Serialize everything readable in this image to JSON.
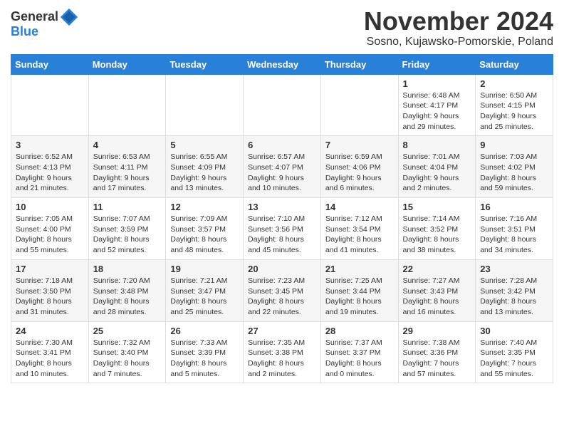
{
  "header": {
    "logo_general": "General",
    "logo_blue": "Blue",
    "month_title": "November 2024",
    "location": "Sosno, Kujawsko-Pomorskie, Poland"
  },
  "weekdays": [
    "Sunday",
    "Monday",
    "Tuesday",
    "Wednesday",
    "Thursday",
    "Friday",
    "Saturday"
  ],
  "weeks": [
    [
      {
        "day": "",
        "info": ""
      },
      {
        "day": "",
        "info": ""
      },
      {
        "day": "",
        "info": ""
      },
      {
        "day": "",
        "info": ""
      },
      {
        "day": "",
        "info": ""
      },
      {
        "day": "1",
        "info": "Sunrise: 6:48 AM\nSunset: 4:17 PM\nDaylight: 9 hours and 29 minutes."
      },
      {
        "day": "2",
        "info": "Sunrise: 6:50 AM\nSunset: 4:15 PM\nDaylight: 9 hours and 25 minutes."
      }
    ],
    [
      {
        "day": "3",
        "info": "Sunrise: 6:52 AM\nSunset: 4:13 PM\nDaylight: 9 hours and 21 minutes."
      },
      {
        "day": "4",
        "info": "Sunrise: 6:53 AM\nSunset: 4:11 PM\nDaylight: 9 hours and 17 minutes."
      },
      {
        "day": "5",
        "info": "Sunrise: 6:55 AM\nSunset: 4:09 PM\nDaylight: 9 hours and 13 minutes."
      },
      {
        "day": "6",
        "info": "Sunrise: 6:57 AM\nSunset: 4:07 PM\nDaylight: 9 hours and 10 minutes."
      },
      {
        "day": "7",
        "info": "Sunrise: 6:59 AM\nSunset: 4:06 PM\nDaylight: 9 hours and 6 minutes."
      },
      {
        "day": "8",
        "info": "Sunrise: 7:01 AM\nSunset: 4:04 PM\nDaylight: 9 hours and 2 minutes."
      },
      {
        "day": "9",
        "info": "Sunrise: 7:03 AM\nSunset: 4:02 PM\nDaylight: 8 hours and 59 minutes."
      }
    ],
    [
      {
        "day": "10",
        "info": "Sunrise: 7:05 AM\nSunset: 4:00 PM\nDaylight: 8 hours and 55 minutes."
      },
      {
        "day": "11",
        "info": "Sunrise: 7:07 AM\nSunset: 3:59 PM\nDaylight: 8 hours and 52 minutes."
      },
      {
        "day": "12",
        "info": "Sunrise: 7:09 AM\nSunset: 3:57 PM\nDaylight: 8 hours and 48 minutes."
      },
      {
        "day": "13",
        "info": "Sunrise: 7:10 AM\nSunset: 3:56 PM\nDaylight: 8 hours and 45 minutes."
      },
      {
        "day": "14",
        "info": "Sunrise: 7:12 AM\nSunset: 3:54 PM\nDaylight: 8 hours and 41 minutes."
      },
      {
        "day": "15",
        "info": "Sunrise: 7:14 AM\nSunset: 3:52 PM\nDaylight: 8 hours and 38 minutes."
      },
      {
        "day": "16",
        "info": "Sunrise: 7:16 AM\nSunset: 3:51 PM\nDaylight: 8 hours and 34 minutes."
      }
    ],
    [
      {
        "day": "17",
        "info": "Sunrise: 7:18 AM\nSunset: 3:50 PM\nDaylight: 8 hours and 31 minutes."
      },
      {
        "day": "18",
        "info": "Sunrise: 7:20 AM\nSunset: 3:48 PM\nDaylight: 8 hours and 28 minutes."
      },
      {
        "day": "19",
        "info": "Sunrise: 7:21 AM\nSunset: 3:47 PM\nDaylight: 8 hours and 25 minutes."
      },
      {
        "day": "20",
        "info": "Sunrise: 7:23 AM\nSunset: 3:45 PM\nDaylight: 8 hours and 22 minutes."
      },
      {
        "day": "21",
        "info": "Sunrise: 7:25 AM\nSunset: 3:44 PM\nDaylight: 8 hours and 19 minutes."
      },
      {
        "day": "22",
        "info": "Sunrise: 7:27 AM\nSunset: 3:43 PM\nDaylight: 8 hours and 16 minutes."
      },
      {
        "day": "23",
        "info": "Sunrise: 7:28 AM\nSunset: 3:42 PM\nDaylight: 8 hours and 13 minutes."
      }
    ],
    [
      {
        "day": "24",
        "info": "Sunrise: 7:30 AM\nSunset: 3:41 PM\nDaylight: 8 hours and 10 minutes."
      },
      {
        "day": "25",
        "info": "Sunrise: 7:32 AM\nSunset: 3:40 PM\nDaylight: 8 hours and 7 minutes."
      },
      {
        "day": "26",
        "info": "Sunrise: 7:33 AM\nSunset: 3:39 PM\nDaylight: 8 hours and 5 minutes."
      },
      {
        "day": "27",
        "info": "Sunrise: 7:35 AM\nSunset: 3:38 PM\nDaylight: 8 hours and 2 minutes."
      },
      {
        "day": "28",
        "info": "Sunrise: 7:37 AM\nSunset: 3:37 PM\nDaylight: 8 hours and 0 minutes."
      },
      {
        "day": "29",
        "info": "Sunrise: 7:38 AM\nSunset: 3:36 PM\nDaylight: 7 hours and 57 minutes."
      },
      {
        "day": "30",
        "info": "Sunrise: 7:40 AM\nSunset: 3:35 PM\nDaylight: 7 hours and 55 minutes."
      }
    ]
  ]
}
